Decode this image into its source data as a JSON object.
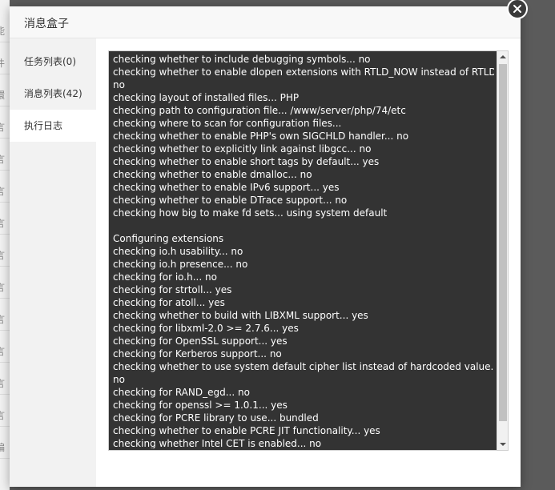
{
  "background_page": {
    "edge_chars": [
      "能",
      "件",
      "環",
      "言",
      "言",
      "言",
      "言",
      "言",
      "言",
      "言",
      "言",
      "言",
      "言",
      "编"
    ]
  },
  "dialog": {
    "title": "消息盒子",
    "close_icon": "close-icon"
  },
  "sidebar": {
    "tabs": [
      {
        "label": "任务列表(0)",
        "active": false
      },
      {
        "label": "消息列表(42)",
        "active": false
      },
      {
        "label": "执行日志",
        "active": true
      }
    ]
  },
  "log": {
    "lines": [
      "checking whether to include debugging symbols... no",
      "checking whether to enable dlopen extensions with RTLD_NOW instead of RTLD_LAZY...",
      "no",
      "checking layout of installed files... PHP",
      "checking path to configuration file... /www/server/php/74/etc",
      "checking where to scan for configuration files...",
      "checking whether to enable PHP's own SIGCHLD handler... no",
      "checking whether to explicitly link against libgcc... no",
      "checking whether to enable short tags by default... yes",
      "checking whether to enable dmalloc... no",
      "checking whether to enable IPv6 support... yes",
      "checking whether to enable DTrace support... no",
      "checking how big to make fd sets... using system default",
      "",
      "Configuring extensions",
      "checking io.h usability... no",
      "checking io.h presence... no",
      "checking for io.h... no",
      "checking for strtoll... yes",
      "checking for atoll... yes",
      "checking whether to build with LIBXML support... yes",
      "checking for libxml-2.0 >= 2.7.6... yes",
      "checking for OpenSSL support... yes",
      "checking for Kerberos support... no",
      "checking whether to use system default cipher list instead of hardcoded value...",
      "no",
      "checking for RAND_egd... no",
      "checking for openssl >= 1.0.1... yes",
      "checking for PCRE library to use... bundled",
      "checking whether to enable PCRE JIT functionality... yes",
      "checking whether Intel CET is enabled... no"
    ]
  },
  "colors": {
    "log_background": "#333333",
    "log_text": "#ffffff",
    "overlay": "#5b5b5b"
  }
}
